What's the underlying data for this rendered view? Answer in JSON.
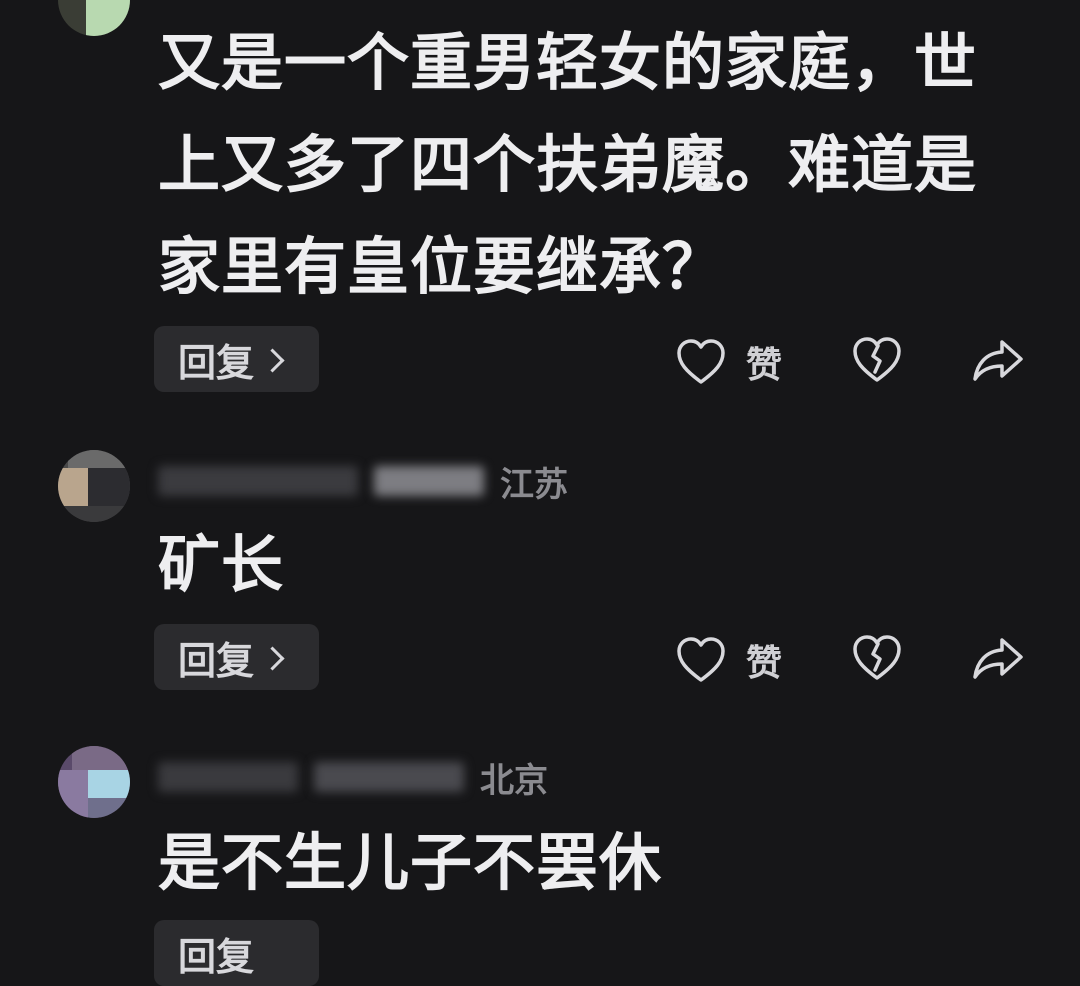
{
  "comments": [
    {
      "location": "",
      "text": "又是一个重男轻女的家庭，世上又多了四个扶弟魔。难道是家里有皇位要继承？",
      "reply_label": "回复",
      "like_label": "赞"
    },
    {
      "location": "江苏",
      "text": "矿长",
      "reply_label": "回复",
      "like_label": "赞"
    },
    {
      "location": "北京",
      "text": "是不生儿子不罢休",
      "reply_label": "回复",
      "like_label": ""
    }
  ],
  "icons": {
    "like": "heart-outline-icon",
    "dislike": "broken-heart-icon",
    "share": "share-arrow-icon"
  },
  "colors": {
    "background": "#161618",
    "text": "#eeeef0",
    "meta": "#8b8b90",
    "button_bg": "#2b2b2e"
  }
}
